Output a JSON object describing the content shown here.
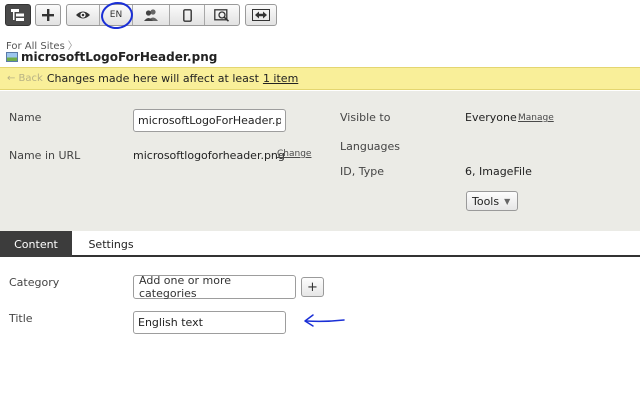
{
  "toolbar": {
    "language_label": "EN",
    "icons": [
      "tree-icon",
      "plus-icon",
      "eye-icon",
      "language-icon",
      "users-icon",
      "mobile-icon",
      "preview-search-icon",
      "swap-icon"
    ]
  },
  "breadcrumb": {
    "text": "For All Sites",
    "separator": "〉"
  },
  "file": {
    "title": "microsoftLogoForHeader.png"
  },
  "warning": {
    "back_label": "← Back",
    "message": "Changes made here will affect at least",
    "link": "1 item"
  },
  "properties": {
    "name_label": "Name",
    "name_value": "microsoftLogoForHeader.png",
    "url_label": "Name in URL",
    "url_value": "microsoftlogoforheader.png",
    "url_change": "Change",
    "visible_label": "Visible to",
    "visible_value": "Everyone",
    "visible_manage": "Manage",
    "languages_label": "Languages",
    "id_label": "ID, Type",
    "id_value": "6, ImageFile",
    "tools_label": "Tools"
  },
  "tabs": [
    {
      "label": "Content",
      "active": true
    },
    {
      "label": "Settings",
      "active": false
    }
  ],
  "content": {
    "category_label": "Category",
    "category_placeholder": "Add one or more categories",
    "add_label": "+",
    "title_label": "Title",
    "title_value": "English text"
  },
  "colors": {
    "warning_bg": "#f9ef99",
    "panel_bg": "#ebebe6",
    "active_tab": "#3c3c3c",
    "annotation": "#1a2fd6"
  }
}
